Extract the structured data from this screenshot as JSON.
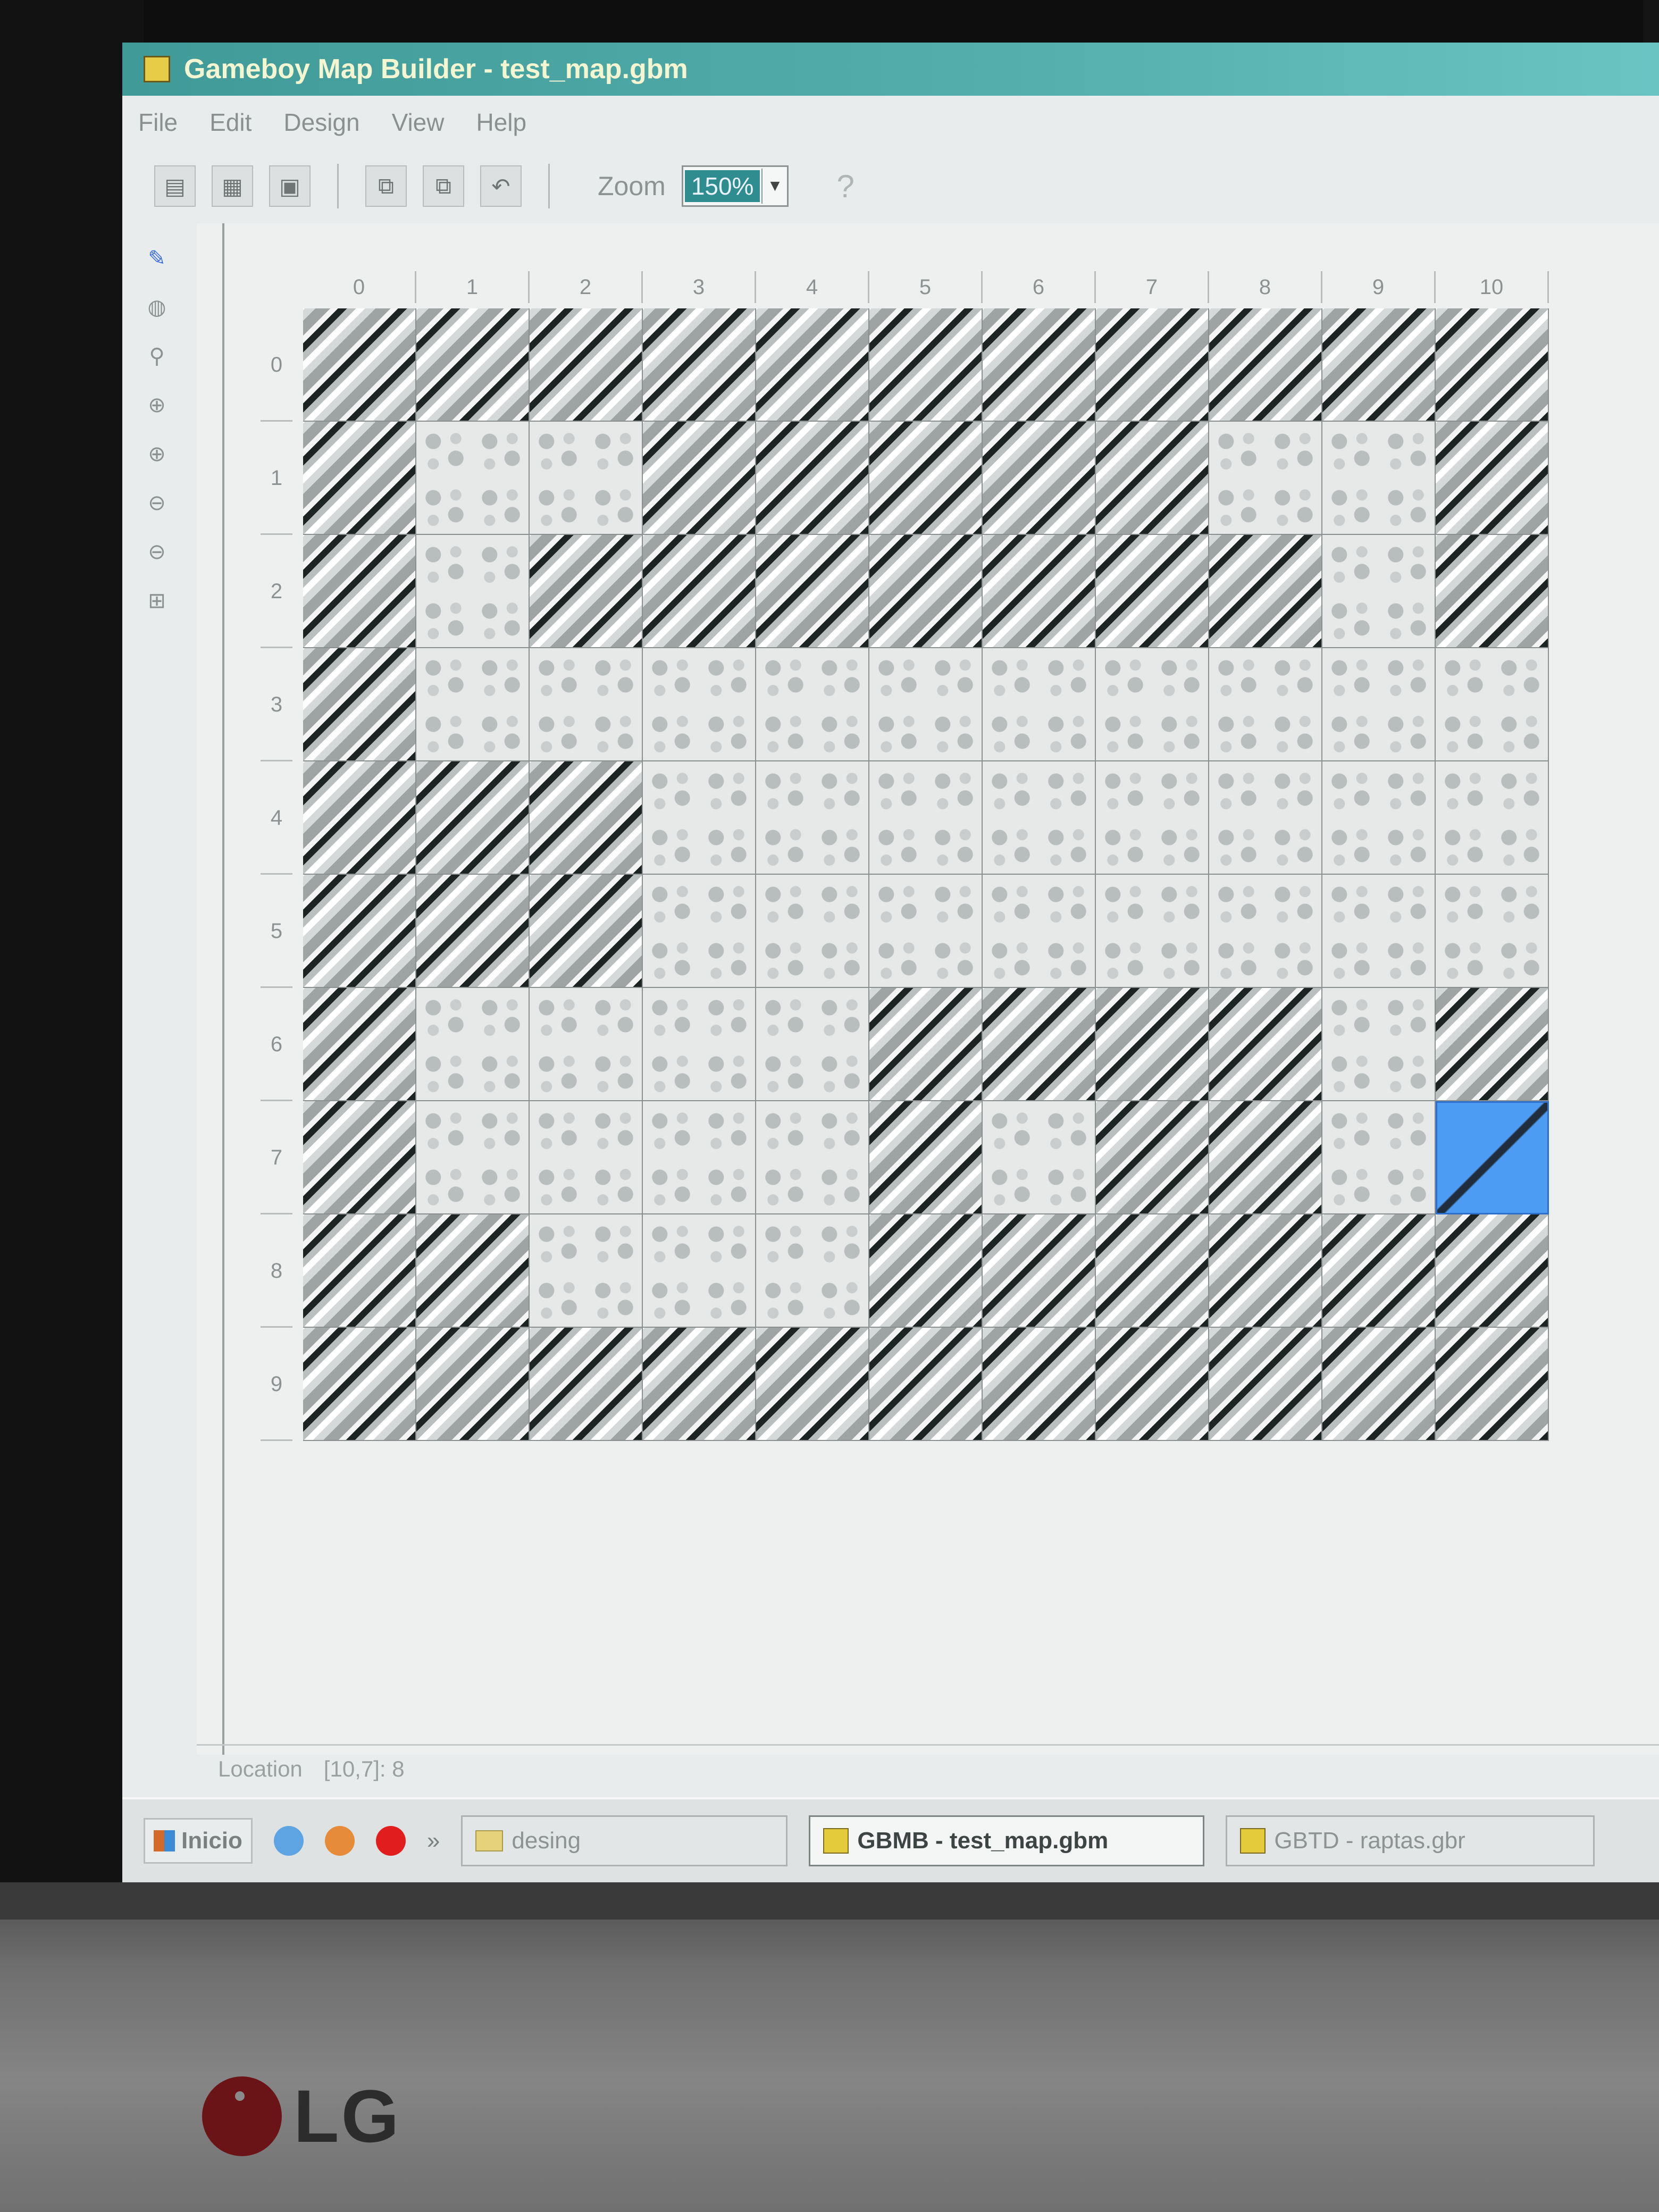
{
  "window": {
    "title": "Gameboy Map Builder - test_map.gbm"
  },
  "menu": [
    "File",
    "Edit",
    "Design",
    "View",
    "Help"
  ],
  "toolbar": {
    "zoom_label": "Zoom",
    "zoom_value": "150%",
    "help_glyph": "?"
  },
  "map": {
    "columns": [
      "0",
      "1",
      "2",
      "3",
      "4",
      "5",
      "6",
      "7",
      "8",
      "9",
      "10"
    ],
    "rows": [
      "0",
      "1",
      "2",
      "3",
      "4",
      "5",
      "6",
      "7",
      "8",
      "9"
    ],
    "tiles": [
      "WWWWWWWWWWW",
      "WFFWWWWWFFW",
      "WFWWWWWWWFW",
      "WFFFFFFFFFF",
      "WWWFFFFFFFF",
      "WWWFFFFFFFF",
      "WFFFFWWWWFW",
      "WFFFFWFWWFS",
      "WWFFFWWWWWW",
      "WWWWWWWWWWW"
    ],
    "selected_cell": "10,7"
  },
  "status": {
    "label": "Location",
    "value": "[10,7]: 8"
  },
  "taskbar": {
    "start_label": "Inicio",
    "quicklaunch_more": "»",
    "tasks": [
      {
        "label": "desing",
        "icon": "folder-icon",
        "active": false
      },
      {
        "label": "GBMB - test_map.gbm",
        "icon": "gbmb-icon",
        "active": true
      },
      {
        "label": "GBTD - raptas.gbr",
        "icon": "gbtd-icon",
        "active": false
      }
    ]
  },
  "brand": {
    "monitor_logo": "LG"
  },
  "colors": {
    "titlebar": "#55b0ad",
    "selection": "#4d9cf3"
  }
}
